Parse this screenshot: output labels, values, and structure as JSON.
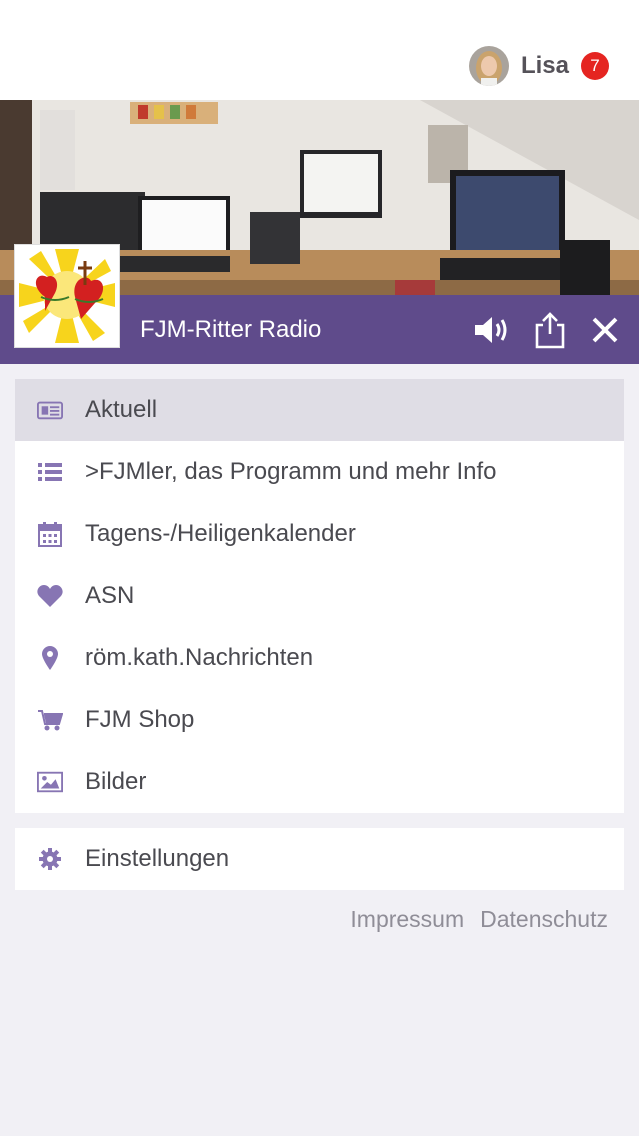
{
  "user": {
    "name": "Lisa",
    "notification_count": "7"
  },
  "station": {
    "title": "FJM-Ritter Radio"
  },
  "menu": {
    "items": [
      {
        "label": "Aktuell",
        "icon": "newspaper-icon",
        "active": true
      },
      {
        "label": ">FJMler, das Programm und mehr Info",
        "icon": "list-icon",
        "active": false
      },
      {
        "label": "Tagens-/Heiligenkalender",
        "icon": "calendar-icon",
        "active": false
      },
      {
        "label": "ASN",
        "icon": "heart-icon",
        "active": false
      },
      {
        "label": "röm.kath.Nachrichten",
        "icon": "map-pin-icon",
        "active": false
      },
      {
        "label": "FJM Shop",
        "icon": "cart-icon",
        "active": false
      },
      {
        "label": "Bilder",
        "icon": "image-icon",
        "active": false
      }
    ],
    "settings": {
      "label": "Einstellungen",
      "icon": "gear-icon"
    }
  },
  "footer": {
    "impressum": "Impressum",
    "datenschutz": "Datenschutz"
  },
  "colors": {
    "accent": "#5f4b8b",
    "icon": "#8775b3",
    "active_row": "#dfdde5",
    "badge": "#e52521",
    "background": "#f1f0f5"
  }
}
